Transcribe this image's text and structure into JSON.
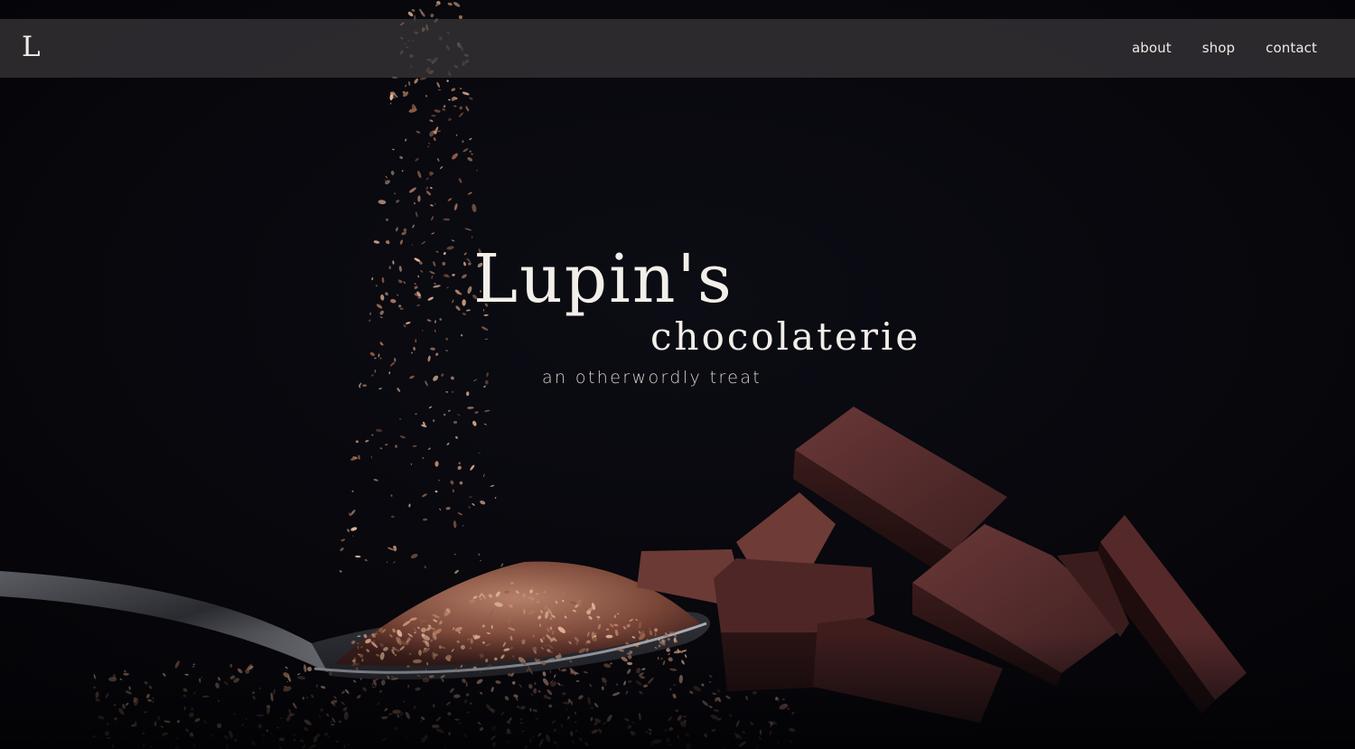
{
  "brand": {
    "logo_letter": "L"
  },
  "nav": {
    "items": [
      {
        "label": "about"
      },
      {
        "label": "shop"
      },
      {
        "label": "contact"
      }
    ]
  },
  "hero": {
    "title": "Lupin's",
    "subtitle": "chocolaterie",
    "tagline": "an otherwordly treat",
    "image_subject": "chocolate-shavings-spoon-and-chocolate-chunks"
  },
  "colors": {
    "background": "#07070c",
    "nav_bar": "#3a383a",
    "text": "#f2efe9",
    "chocolate": "#4a2424",
    "shavings": "#c48f72"
  }
}
